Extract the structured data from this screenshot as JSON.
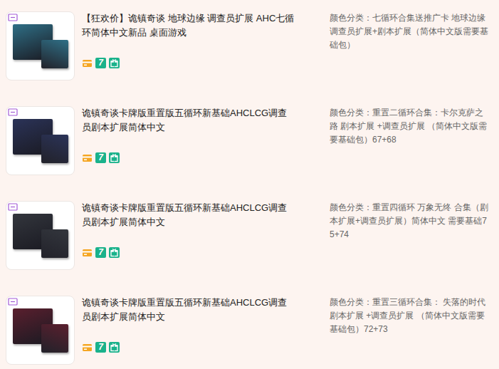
{
  "items": [
    {
      "title": "【狂欢价】诡镇奇谈 地球边缘 调查员扩展 AHC七循环简体中文新品 桌面游戏",
      "spec": "颜色分类：七循环合集送推广卡 地球边缘 调查员扩展+剧本扩展（简体中文版需要基础包）",
      "color": "#2f6f86"
    },
    {
      "title": "诡镇奇谈卡牌版重置版五循环新基础AHCLCG调查员剧本扩展简体中文",
      "spec": "颜色分类：重置二循环合集：卡尔克萨之路 剧本扩展 +调查员扩展 （简体中文版需要基础包）67+68",
      "color": "#2b3358"
    },
    {
      "title": "诡镇奇谈卡牌版重置版五循环新基础AHCLCG调查员剧本扩展简体中文",
      "spec": "颜色分类：重置四循环 万象无终 合集（剧本扩展+调查员扩展）简体中文 需要基础75+74",
      "color": "#33363d"
    },
    {
      "title": "诡镇奇谈卡牌版重置版五循环新基础AHCLCG调查员剧本扩展简体中文",
      "spec": "颜色分类：重置三循环合集： 失落的时代 剧本扩展 +调查员扩展 （简体中文版需要基础包）72+73",
      "color": "#5a1f2e"
    }
  ],
  "service_icons": [
    {
      "kind": "card",
      "label": ""
    },
    {
      "kind": "seven",
      "label": "7"
    },
    {
      "kind": "gift",
      "label": ""
    }
  ]
}
